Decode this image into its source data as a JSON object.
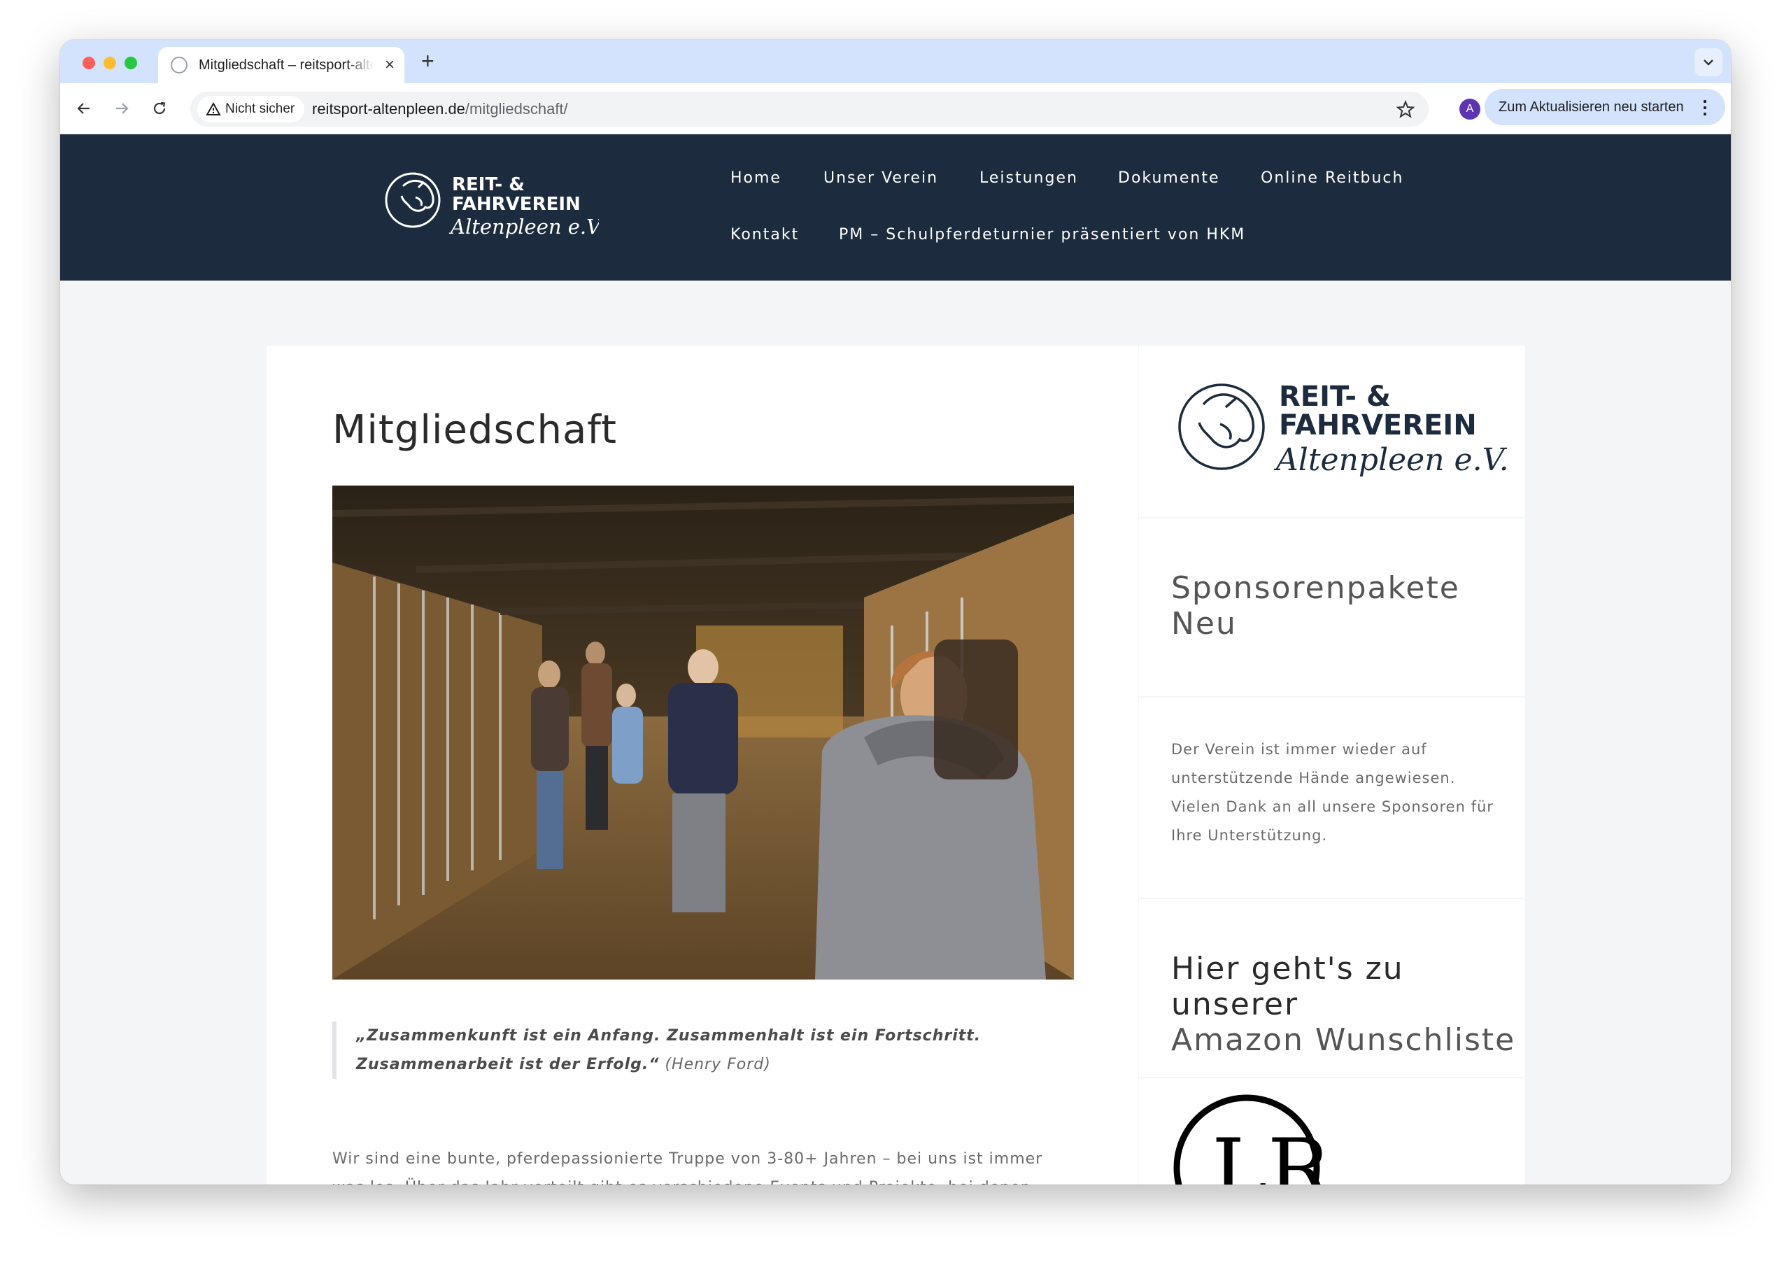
{
  "browser": {
    "tab_title": "Mitgliedschaft – reitsport-altenpleen.de",
    "new_tab": "+",
    "close": "×",
    "security_label": "Nicht sicher",
    "url_host": "reitsport-altenpleen.de",
    "url_path": "/mitgliedschaft/",
    "avatar_letter": "A",
    "update_label": "Zum Aktualisieren neu starten"
  },
  "site": {
    "logo": {
      "line1": "REIT- &",
      "line2": "FAHRVEREIN",
      "script": "Altenpleen e.V."
    },
    "nav": [
      {
        "label": "Home"
      },
      {
        "label": "Unser Verein"
      },
      {
        "label": "Leistungen"
      },
      {
        "label": "Dokumente"
      },
      {
        "label": "Online Reitbuch"
      },
      {
        "label": "Kontakt"
      },
      {
        "label": "PM – Schulpferdeturnier präsentiert von HKM"
      }
    ]
  },
  "main": {
    "title": "Mitgliedschaft",
    "quote": "„Zusammenkunft ist ein Anfang. Zusammenhalt ist ein Fortschritt. Zusammenarbeit ist der Erfolg.“",
    "quote_author": "(Henry Ford)",
    "body": "Wir sind eine bunte, pferdepassionierte Truppe von 3-80+ Jahren – bei uns ist immer was los. Über das Jahr verteilt gibt es verschiedene Events und Projekte, bei denen die Gemeinnützigkeit unserer Mitglieder gefragt ist. Gemeinsam realisieren wir Projekte, um"
  },
  "sidebar": {
    "sponsor_line1": "Sponsorenpakete",
    "sponsor_line2": "Neu",
    "sponsor_text": "Der Verein ist immer wieder auf unterstützende Hände angewiesen. Vielen Dank an all unsere Sponsoren für Ihre Unterstützung.",
    "amazon_line1": "Hier geht's zu unserer",
    "amazon_line2": "Amazon Wunschliste",
    "lr_logo_text": "LR"
  },
  "colors": {
    "header_bg": "#1c2c3e",
    "tab_strip": "#d3e3fd",
    "page_bg": "#f4f5f6",
    "logo_dark": "#1c2c3e"
  }
}
